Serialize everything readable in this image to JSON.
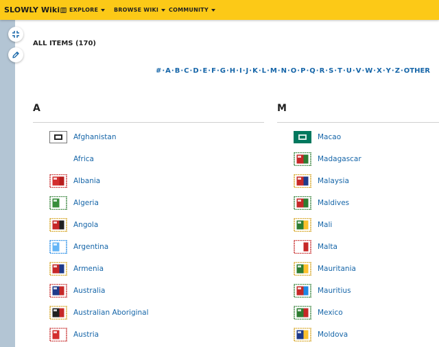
{
  "header": {
    "brand": "SLOWLY Wiki",
    "nav": [
      {
        "label": "EXPLORE",
        "icon": "map-icon"
      },
      {
        "label": "BROWSE WIKI"
      },
      {
        "label": "COMMUNITY"
      }
    ]
  },
  "toolbar": {
    "expand_icon": "compress-icon",
    "edit_icon": "pencil-icon"
  },
  "page": {
    "title": "ALL ITEMS (170)",
    "alphabet": [
      "#",
      "A",
      "B",
      "C",
      "D",
      "E",
      "F",
      "G",
      "H",
      "I",
      "J",
      "K",
      "L",
      "M",
      "N",
      "O",
      "P",
      "Q",
      "R",
      "S",
      "T",
      "U",
      "V",
      "W",
      "X",
      "Y",
      "Z",
      "OTHER"
    ]
  },
  "sections": [
    {
      "letter": "A",
      "items": [
        {
          "label": "Afghanistan",
          "stamp": {
            "kind": "flag",
            "border": "#777777",
            "colors": [
              "#ffffff",
              "#000000",
              "#ffffff"
            ]
          }
        },
        {
          "label": "Africa",
          "stamp": null
        },
        {
          "label": "Albania",
          "stamp": {
            "kind": "stamp",
            "border": "#c62828",
            "colors": [
              "#d32f2f",
              "#b71c1c"
            ]
          }
        },
        {
          "label": "Algeria",
          "stamp": {
            "kind": "stamp",
            "border": "#2e7d32",
            "colors": [
              "#388e3c",
              "#ffffff"
            ]
          }
        },
        {
          "label": "Angola",
          "stamp": {
            "kind": "stamp",
            "border": "#d4a017",
            "colors": [
              "#c62828",
              "#212121"
            ]
          }
        },
        {
          "label": "Argentina",
          "stamp": {
            "kind": "stamp",
            "border": "#1e88e5",
            "colors": [
              "#64b5f6",
              "#ffffff"
            ]
          }
        },
        {
          "label": "Armenia",
          "stamp": {
            "kind": "stamp",
            "border": "#d4a017",
            "colors": [
              "#c62828",
              "#1e3a8a"
            ]
          }
        },
        {
          "label": "Australia",
          "stamp": {
            "kind": "stamp",
            "border": "#c62828",
            "colors": [
              "#1e3a8a",
              "#c62828"
            ]
          }
        },
        {
          "label": "Australian Aboriginal",
          "stamp": {
            "kind": "stamp",
            "border": "#d4a017",
            "colors": [
              "#212121",
              "#c62828"
            ]
          }
        },
        {
          "label": "Austria",
          "stamp": {
            "kind": "stamp",
            "border": "#c62828",
            "colors": [
              "#d32f2f",
              "#ffffff"
            ]
          }
        }
      ]
    },
    {
      "letter": "M",
      "items": [
        {
          "label": "Macao",
          "stamp": {
            "kind": "flag",
            "border": "#00785e",
            "colors": [
              "#00785e",
              "#ffffff"
            ]
          }
        },
        {
          "label": "Madagascar",
          "stamp": {
            "kind": "stamp",
            "border": "#2e7d32",
            "colors": [
              "#c62828",
              "#2e7d32"
            ]
          }
        },
        {
          "label": "Malaysia",
          "stamp": {
            "kind": "stamp",
            "border": "#d4a017",
            "colors": [
              "#c62828",
              "#1e3a8a"
            ]
          }
        },
        {
          "label": "Maldives",
          "stamp": {
            "kind": "stamp",
            "border": "#2e7d32",
            "colors": [
              "#c62828",
              "#2e7d32"
            ]
          }
        },
        {
          "label": "Mali",
          "stamp": {
            "kind": "stamp",
            "border": "#d4a017",
            "colors": [
              "#2e7d32",
              "#fbc02d"
            ]
          }
        },
        {
          "label": "Malta",
          "stamp": {
            "kind": "stamp",
            "border": "#c62828",
            "colors": [
              "#ffffff",
              "#c62828"
            ]
          }
        },
        {
          "label": "Mauritania",
          "stamp": {
            "kind": "stamp",
            "border": "#d4a017",
            "colors": [
              "#2e7d32",
              "#fbc02d"
            ]
          }
        },
        {
          "label": "Mauritius",
          "stamp": {
            "kind": "stamp",
            "border": "#2e7d32",
            "colors": [
              "#c62828",
              "#1e88e5"
            ]
          }
        },
        {
          "label": "Mexico",
          "stamp": {
            "kind": "stamp",
            "border": "#2e7d32",
            "colors": [
              "#2e7d32",
              "#c62828"
            ]
          }
        },
        {
          "label": "Moldova",
          "stamp": {
            "kind": "stamp",
            "border": "#d4a017",
            "colors": [
              "#1e3a8a",
              "#fbc02d"
            ]
          }
        }
      ]
    }
  ],
  "colors": {
    "header_bg": "#fcc917",
    "link": "#1565a8",
    "rail_bg": "#b3c5d4"
  }
}
